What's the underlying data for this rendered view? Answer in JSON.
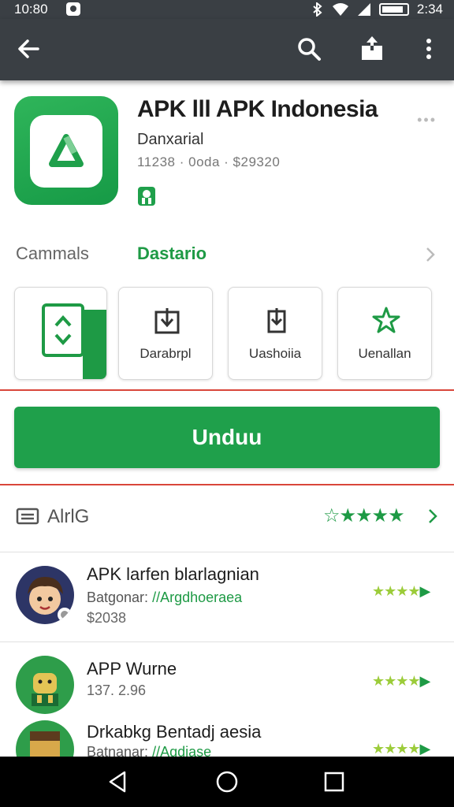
{
  "status_bar": {
    "time": "10:80",
    "clock": "2:34"
  },
  "toolbar": {
    "back_icon": "arrow-left-icon",
    "search_icon": "search-icon",
    "share_icon": "share-icon",
    "more_icon": "more-vert-icon"
  },
  "app": {
    "title": "APK lll APK Indonesia",
    "developer": "Danxarial",
    "meta": "11238 · 0oda · $29320",
    "brand_color": "#1fa04b"
  },
  "category": {
    "label": "Cammals",
    "value": "Dastario"
  },
  "tiles": [
    {
      "label": ""
    },
    {
      "label": "Darabrpl"
    },
    {
      "label": "Uashoiia"
    },
    {
      "label": "Uenallan"
    }
  ],
  "install": {
    "label": "Unduu"
  },
  "section": {
    "label": "AlrlG",
    "stars": "☆★★★★"
  },
  "list": [
    {
      "title": "APK larfen blarlagnian",
      "sub_prefix": "Batgonar: ",
      "sub_highlight": "//Argdhoeraea",
      "price": "$2038"
    },
    {
      "title": "APP Wurne",
      "sub_prefix": "",
      "sub_highlight": "",
      "price": "137. 2.96"
    },
    {
      "title": "Drkabkg Bentadj aesia",
      "sub_prefix": "Batnanar: ",
      "sub_highlight": "//Agdiase",
      "price": ""
    }
  ]
}
